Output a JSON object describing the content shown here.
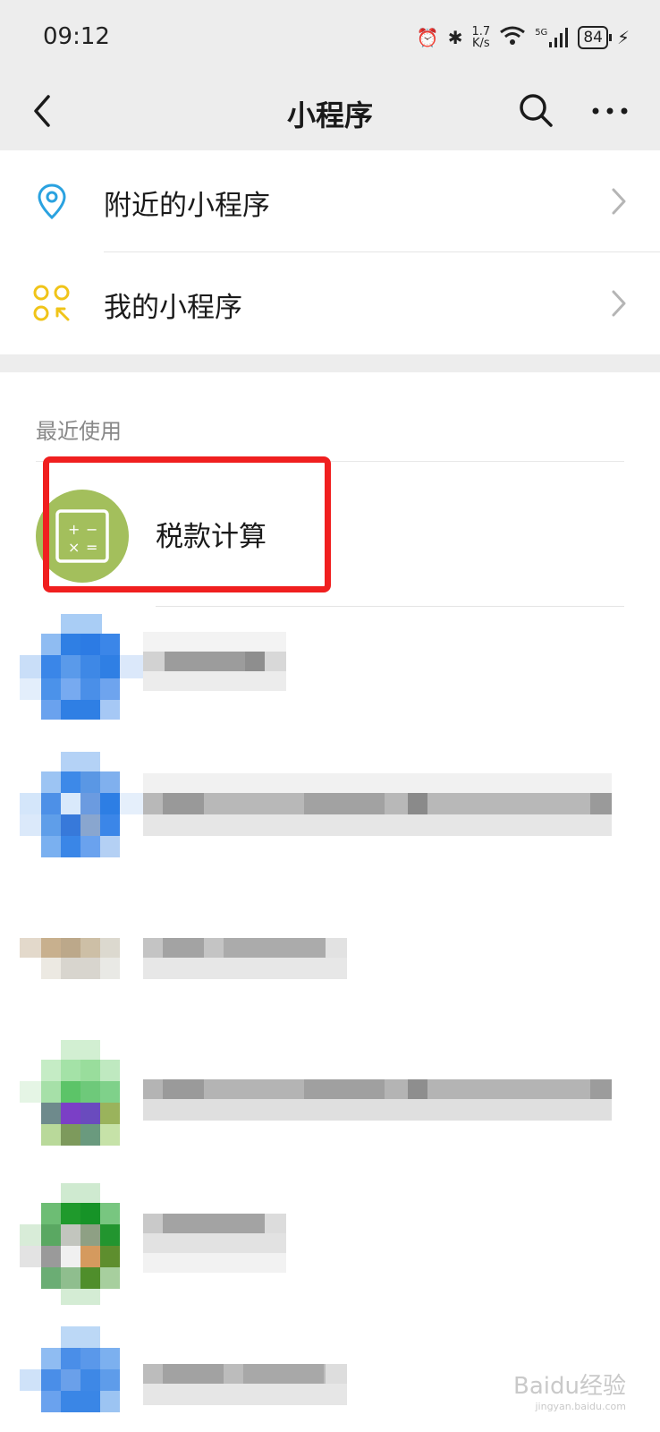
{
  "status_bar": {
    "time": "09:12",
    "speed_top": "1.7",
    "speed_bottom": "K/s",
    "network": "5G",
    "battery": "84"
  },
  "nav": {
    "title": "小程序",
    "back_icon": "chevron-left-icon",
    "search_icon": "search-icon",
    "more_icon": "more-dots-icon"
  },
  "menu": {
    "items": [
      {
        "label": "附近的小程序",
        "icon": "location-pin-icon",
        "color": "#2aa2e0"
      },
      {
        "label": "我的小程序",
        "icon": "mini-program-grid-icon",
        "color": "#f0c419"
      }
    ]
  },
  "recent": {
    "title": "最近使用",
    "items": [
      {
        "name": "税款计算",
        "icon": "calculator-icon",
        "color": "#a3bf5c"
      }
    ]
  },
  "watermark": {
    "text": "Baidu经验",
    "sub": "jingyan.baidu.com"
  },
  "colors": {
    "nav_bg": "#ededed",
    "highlight": "#f01f1f"
  }
}
